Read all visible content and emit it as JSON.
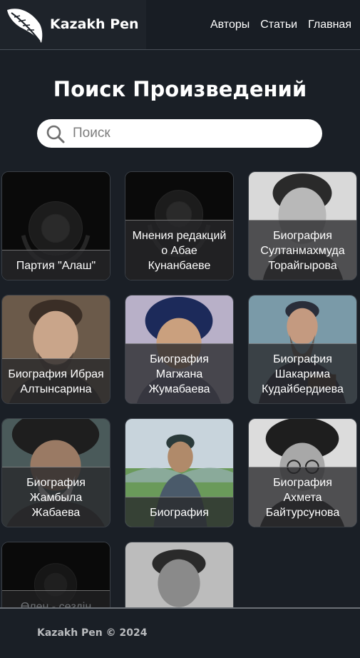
{
  "brand": {
    "name": "Kazakh Pen"
  },
  "nav": {
    "authors": "Авторы",
    "articles": "Статьи",
    "home": "Главная"
  },
  "page": {
    "title": "Поиск Произведений"
  },
  "search": {
    "placeholder": "Поиск"
  },
  "cards": [
    {
      "caption": "Партия \"Алаш\""
    },
    {
      "caption": "Мнения редакций о Абае Кунанбаеве"
    },
    {
      "caption": "Биография Султанмахмуда Торайгырова"
    },
    {
      "caption": "Биография Ибрая Алтынсарина"
    },
    {
      "caption": "Биография Магжана Жумабаева"
    },
    {
      "caption": "Биография Шакарима Кудайбердиева"
    },
    {
      "caption": "Биография Жамбыла Жабаева"
    },
    {
      "caption": "Биография"
    },
    {
      "caption": "Биография Ахмета Байтурсунова"
    },
    {
      "caption": "Өлең - сөздің"
    },
    {
      "caption": ""
    }
  ],
  "footer": {
    "text": "Kazakh Pen © 2024"
  }
}
